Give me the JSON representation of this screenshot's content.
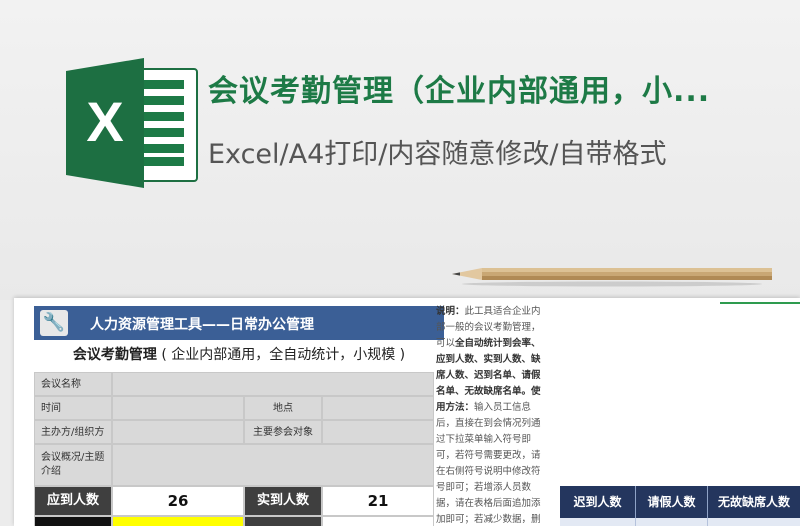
{
  "header": {
    "title": "会议考勤管理（企业内部通用，小...",
    "subtitle": "Excel/A4打印/内容随意修改/自带格式"
  },
  "logo": {
    "icon": "excel-icon",
    "letter": "X",
    "brand_color": "#1d7a46"
  },
  "sheet": {
    "tool_title": "人力资源管理工具——日常办公管理",
    "form_title_main": "会议考勤管理",
    "form_title_note": "( 企业内部通用，全自动统计，小规模 )",
    "fields": {
      "meeting_name": "会议名称",
      "time": "时间",
      "location": "地点",
      "host": "主办方/组织方",
      "main_attendees": "主要参会对象",
      "summary": "会议概况/主题介绍"
    },
    "counts": {
      "expected_label": "应到人数",
      "expected_value": "26",
      "actual_label": "实到人数",
      "actual_value": "21"
    },
    "instructions": {
      "lead": "说明：",
      "p1": "此工具适合企业内部一般的会议考勤管理，可以",
      "p1b": "全自动统计到会率、应到人数、实到人数、缺席人数、迟到名单、请假名单、无故缺席名单。",
      "usage_lead": "使用方法：",
      "p2": "输入员工信息后，直接在到会情况列通过下拉菜单输入符号即可，若符号需要更改，请在右侧符号说明中修改符号即可；若增添人员数据，请在表格后面追加添加即可；若减少数据，删除所有信息即可，但不要"
    },
    "stats_headers": [
      "迟到人数",
      "请假人数",
      "无故缺席人数"
    ]
  },
  "colors": {
    "header_blue": "#3b5f96",
    "stats_navy": "#24365e",
    "label_gray": "#d9d9d9",
    "dark_cell": "#3f3f3f",
    "highlight_yellow": "#ffff00"
  }
}
